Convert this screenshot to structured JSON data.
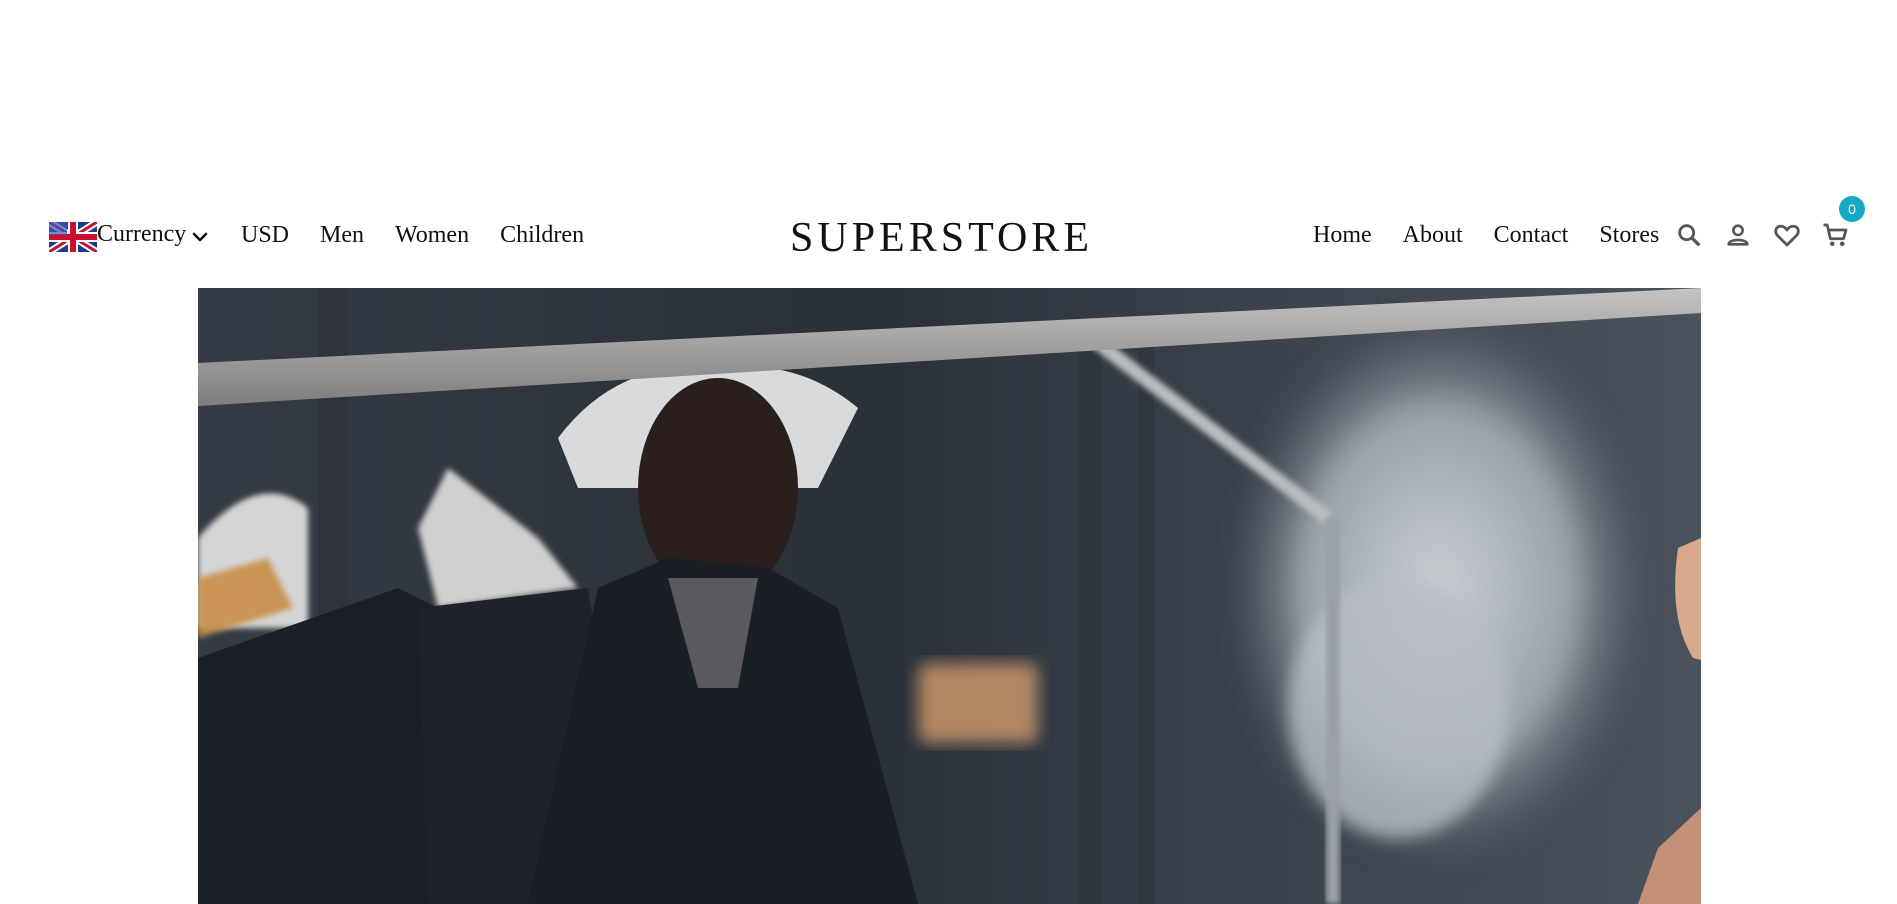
{
  "header": {
    "flag_icon": "uk-flag-icon",
    "currency_label": "Currency",
    "currency_code": "USD",
    "left_nav": [
      "Men",
      "Women",
      "Children"
    ],
    "brand": "SUPERSTORE",
    "right_nav": [
      "Home",
      "About",
      "Contact",
      "Stores"
    ],
    "icons": [
      "search-icon",
      "user-icon",
      "heart-icon",
      "cart-icon"
    ],
    "cart_count": "0",
    "badge_color": "#14a9c4"
  },
  "hero": {
    "image": "fashion-hero-image"
  }
}
